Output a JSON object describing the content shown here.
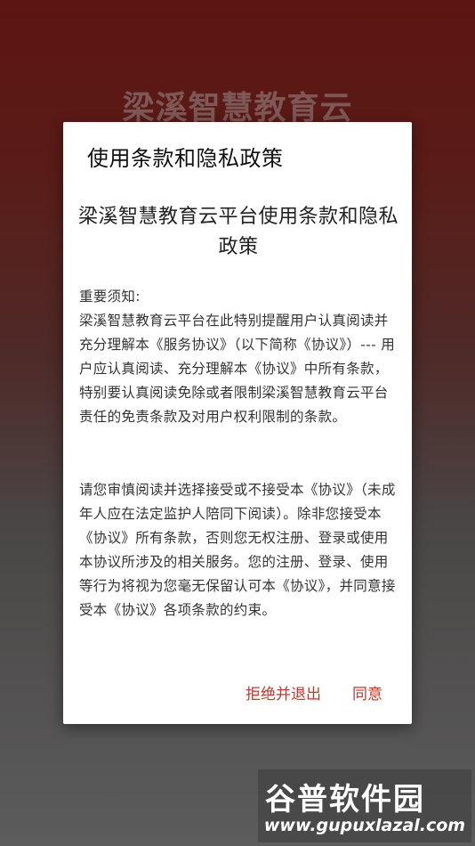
{
  "background": {
    "app_title": "梁溪智慧教育云"
  },
  "dialog": {
    "title": "使用条款和隐私政策",
    "doc_heading": "梁溪智慧教育云平台使用条款和隐私政策",
    "notice_label": "重要须知:",
    "paragraph1": "梁溪智慧教育云平台在此特别提醒用户认真阅读并充分理解本《服务协议》（以下简称《协议》）--- 用户应认真阅读、充分理解本《协议》中所有条款，特别要认真阅读免除或者限制梁溪智慧教育云平台责任的免责条款及对用户权利限制的条款。",
    "paragraph2": "请您审慎阅读并选择接受或不接受本《协议》（未成年人应在法定监护人陪同下阅读）。除非您接受本《协议》所有条款，否则您无权注册、登录或使用本协议所涉及的相关服务。您的注册、登录、使用等行为将视为您毫无保留认可本《协议》，并同意接受本《协议》各项条款的约束。",
    "refuse_label": "拒绝并退出",
    "agree_label": "同意"
  },
  "watermark": {
    "logo": "谷普软件园",
    "url": "www.gupuxlazal.com"
  },
  "colors": {
    "accent": "#c0392b",
    "background_top": "#5c1512"
  }
}
